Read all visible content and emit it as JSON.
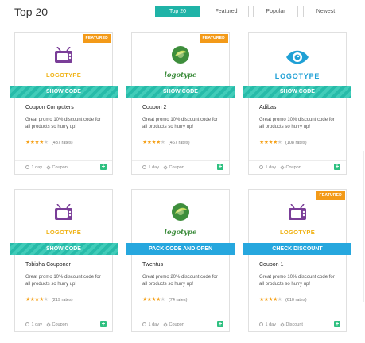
{
  "title": "Top 20",
  "tabs": [
    {
      "label": "Top 20",
      "active": true
    },
    {
      "label": "Featured",
      "active": false
    },
    {
      "label": "Popular",
      "active": false
    },
    {
      "label": "Newest",
      "active": false
    }
  ],
  "cards": [
    {
      "featured": true,
      "ribbon": "FEATURED",
      "logo_type": "tv-icon",
      "logo_text": "LOGOTYPE",
      "button": "SHOW CODE",
      "button_color": "#27bba9",
      "name": "Coupon Computers",
      "desc": "Great promo 10% discount code for all products so hurry up!",
      "stars": 4,
      "rates": "(437 rates)",
      "age": "1 day",
      "tag": "Coupon"
    },
    {
      "featured": true,
      "ribbon": "FEATURED",
      "logo_type": "lemon-icon",
      "logo_text": "logotype",
      "button": "SHOW CODE",
      "button_color": "#27bba9",
      "name": "Coupon 2",
      "desc": "Great promo 10% discount code for all products so hurry up!",
      "stars": 4,
      "rates": "(467 rates)",
      "age": "1 day",
      "tag": "Coupon"
    },
    {
      "featured": false,
      "ribbon": "",
      "logo_type": "eye-icon",
      "logo_text": "LOGOTYPE",
      "button": "SHOW CODE",
      "button_color": "#27bba9",
      "name": "Adibas",
      "desc": "Great promo 10% discount code for all products so hurry up!",
      "stars": 4,
      "rates": "(108 rates)",
      "age": "1 day",
      "tag": "Coupon"
    },
    {
      "featured": false,
      "ribbon": "",
      "logo_type": "tv-icon",
      "logo_text": "LOGOTYPE",
      "button": "SHOW CODE",
      "button_color": "#27bba9",
      "name": "Tobisha Couponer",
      "desc": "Great promo 10% discount code for all products so hurry up!",
      "stars": 4,
      "rates": "(219 rates)",
      "age": "1 day",
      "tag": "Coupon"
    },
    {
      "featured": false,
      "ribbon": "",
      "logo_type": "lemon-icon",
      "logo_text": "logotype",
      "button": "PACK CODE AND OPEN",
      "button_color": "#26a7de",
      "name": "Twentus",
      "desc": "Great promo 20% discount code for all products so hurry up!",
      "stars": 4,
      "rates": "(74 rates)",
      "age": "1 day",
      "tag": "Coupon"
    },
    {
      "featured": true,
      "ribbon": "FEATURED",
      "logo_type": "tv-icon",
      "logo_text": "LOGOTYPE",
      "button": "CHECK DISCOUNT",
      "button_color": "#26a7de",
      "name": "Coupon 1",
      "desc": "Great promo 10% discount code for all products so hurry up!",
      "stars": 4,
      "rates": "(610 rates)",
      "age": "1 day",
      "tag": "Discount"
    }
  ],
  "colors": {
    "accent": "#1fb3a7",
    "ribbon": "#f39a18",
    "star": "#f5a21c",
    "add": "#2ec080"
  }
}
